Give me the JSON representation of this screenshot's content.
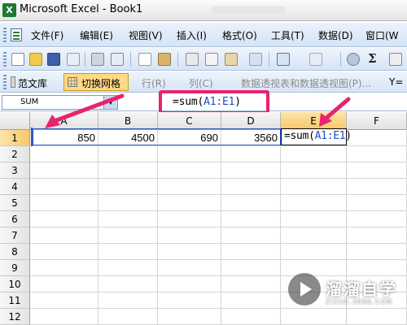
{
  "window": {
    "title": "Microsoft Excel - Book1",
    "app_icon": "excel-icon"
  },
  "menu": {
    "items": [
      {
        "label": "文件(F)"
      },
      {
        "label": "编辑(E)"
      },
      {
        "label": "视图(V)"
      },
      {
        "label": "插入(I)"
      },
      {
        "label": "格式(O)"
      },
      {
        "label": "工具(T)"
      },
      {
        "label": "数据(D)"
      },
      {
        "label": "窗口(W"
      }
    ]
  },
  "toolbar1": {
    "sigma": "Σ"
  },
  "toolbar2": {
    "fanwenku": "范文库",
    "toggle_grid": "切换网格",
    "row": "行(R)",
    "col": "列(C)",
    "pivot": "数据透视表和数据透视图(P)...",
    "tail": "Y="
  },
  "formula_bar": {
    "name_box": "SUM",
    "formula_prefix": "=sum(",
    "formula_ref": "A1:E1",
    "formula_suffix": ")"
  },
  "grid": {
    "columns": [
      "A",
      "B",
      "C",
      "D",
      "E",
      "F"
    ],
    "rows": [
      "1",
      "2",
      "3",
      "4",
      "5",
      "6",
      "7",
      "8",
      "9",
      "10",
      "11",
      "12"
    ],
    "row1": [
      "850",
      "4500",
      "690",
      "3560"
    ],
    "active_cell": {
      "prefix": "=sum(",
      "ref": "A1:E1",
      "suffix": ")"
    }
  },
  "watermark": {
    "title": "溜溜自学",
    "url": "ZIXUE.3066.COM"
  },
  "colors": {
    "callout": "#e8246c",
    "range": "#2b56c8",
    "active_header": "#f6c86a"
  }
}
